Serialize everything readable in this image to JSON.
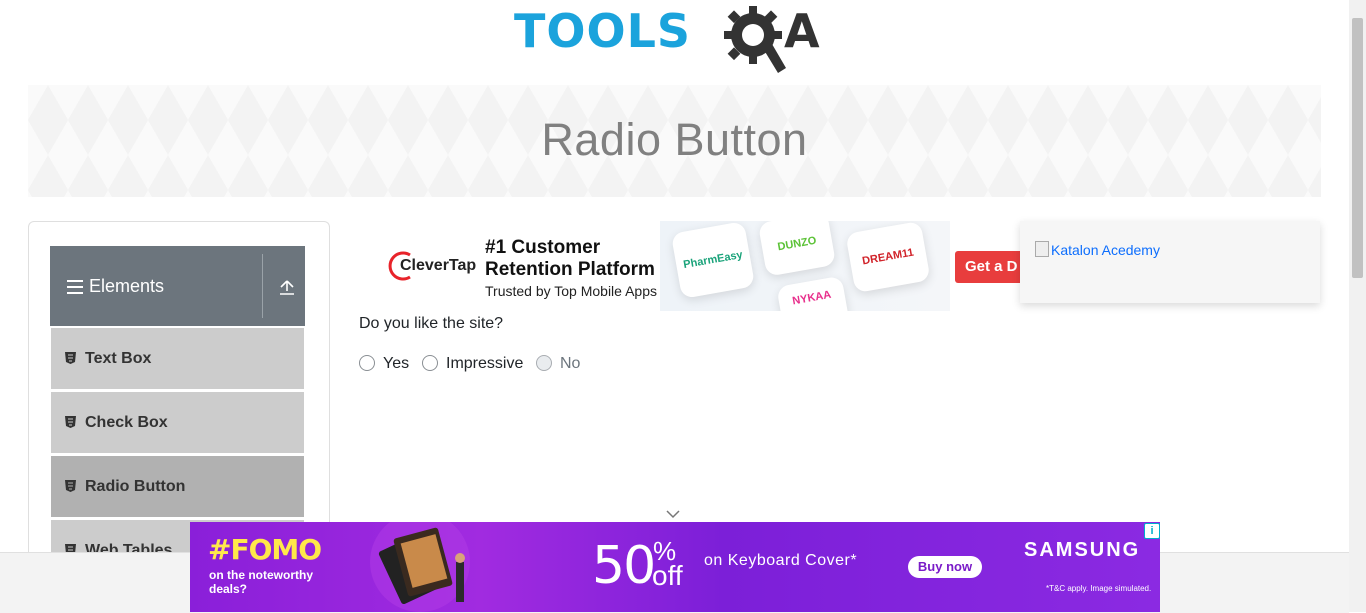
{
  "header": {
    "logo_tools": "TOOLS",
    "logo_a": "A"
  },
  "banner": {
    "title": "Radio Button"
  },
  "sidebar": {
    "group_title": "Elements",
    "items": [
      {
        "label": "Text Box"
      },
      {
        "label": "Check Box"
      },
      {
        "label": "Radio Button",
        "active": true
      },
      {
        "label": "Web Tables"
      }
    ]
  },
  "ad_top": {
    "brand": "CleverTap",
    "headline": "#1 Customer Retention Platform",
    "subline": "Trusted by Top Mobile Apps",
    "cards": [
      "PharmEasy",
      "DUNZO",
      "DREAM11",
      "NYKAA"
    ],
    "cta": "Get a D"
  },
  "side_ad": {
    "alt_text": "Katalon Acedemy"
  },
  "form": {
    "question": "Do you like the site?",
    "options": [
      {
        "label": "Yes",
        "disabled": false
      },
      {
        "label": "Impressive",
        "disabled": false
      },
      {
        "label": "No",
        "disabled": true
      }
    ]
  },
  "ad_bottom": {
    "fomo": "#FOMO",
    "fomo_sub": "on the noteworthy deals?",
    "deal_number": "50",
    "deal_percent": "%",
    "deal_off": "off",
    "deal_text": "on Keyboard Cover*",
    "cta": "Buy now",
    "brand": "SAMSUNG",
    "disclaimer": "*T&C apply. Image simulated.",
    "adchoice": "i"
  },
  "colors": {
    "accent": "#1ba3dc",
    "sidebar_header": "#6c757d",
    "menu_item": "#cccccc",
    "menu_active": "#b1b1b1"
  }
}
